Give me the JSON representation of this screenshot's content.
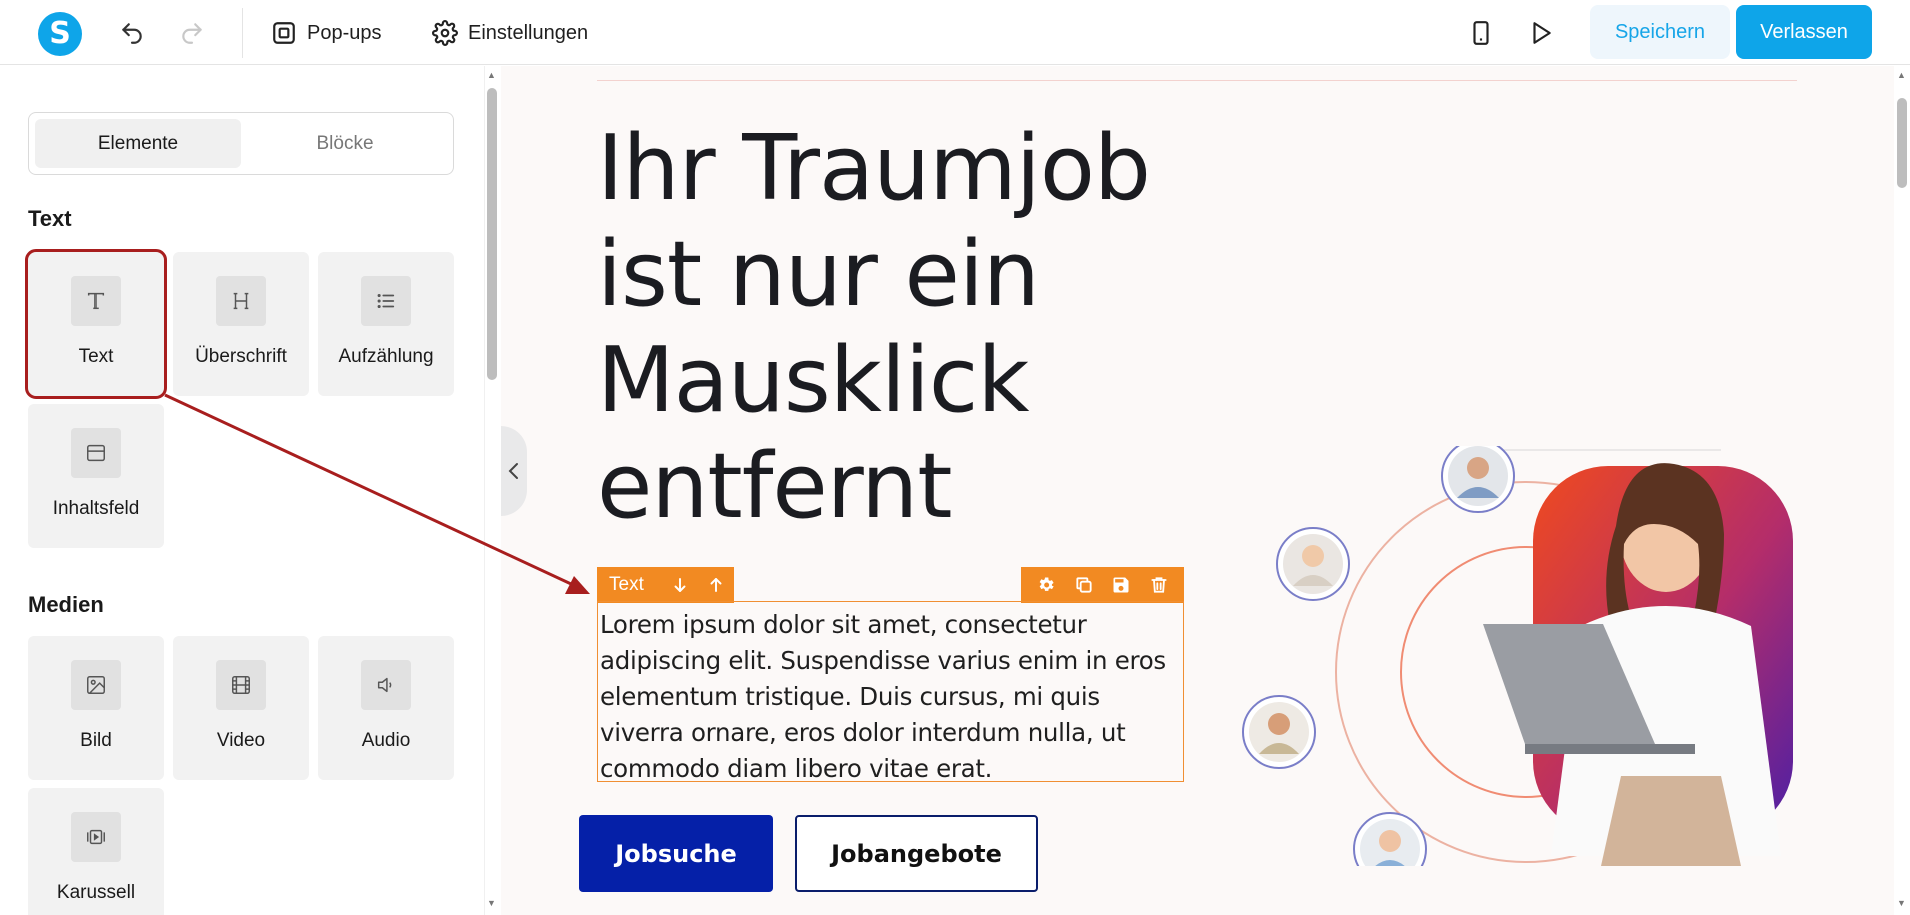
{
  "topbar": {
    "logo_letter": "S",
    "popups_label": "Pop-ups",
    "settings_label": "Einstellungen",
    "save_label": "Speichern",
    "leave_label": "Verlassen",
    "brand_color": "#0ea5e9"
  },
  "sidebar": {
    "tabs": [
      {
        "label": "Elemente",
        "active": true
      },
      {
        "label": "Blöcke",
        "active": false
      }
    ],
    "sections": [
      {
        "title": "Text",
        "items": [
          {
            "label": "Text",
            "icon": "text-icon",
            "selected": true
          },
          {
            "label": "Überschrift",
            "icon": "heading-icon"
          },
          {
            "label": "Aufzählung",
            "icon": "list-icon"
          },
          {
            "label": "Inhaltsfeld",
            "icon": "content-box-icon"
          }
        ]
      },
      {
        "title": "Medien",
        "items": [
          {
            "label": "Bild",
            "icon": "image-icon"
          },
          {
            "label": "Video",
            "icon": "video-icon"
          },
          {
            "label": "Audio",
            "icon": "audio-icon"
          },
          {
            "label": "Karussell",
            "icon": "carousel-icon"
          }
        ]
      }
    ]
  },
  "canvas": {
    "hero_title_lines": [
      "Ihr Traumjob",
      "ist nur ein",
      "Mausklick",
      "entfernt"
    ],
    "text_block": {
      "toolbar_label": "Text",
      "body": "Lorem ipsum dolor sit amet, consectetur adipiscing elit. Suspendisse varius enim in eros elementum tristique. Duis cursus, mi quis viverra ornare, eros dolor interdum nulla, ut commodo diam libero vitae erat."
    },
    "primary_button": "Jobsuche",
    "secondary_button": "Jobangebote",
    "accent_orange": "#f28a22",
    "primary_blue": "#0520a8"
  }
}
